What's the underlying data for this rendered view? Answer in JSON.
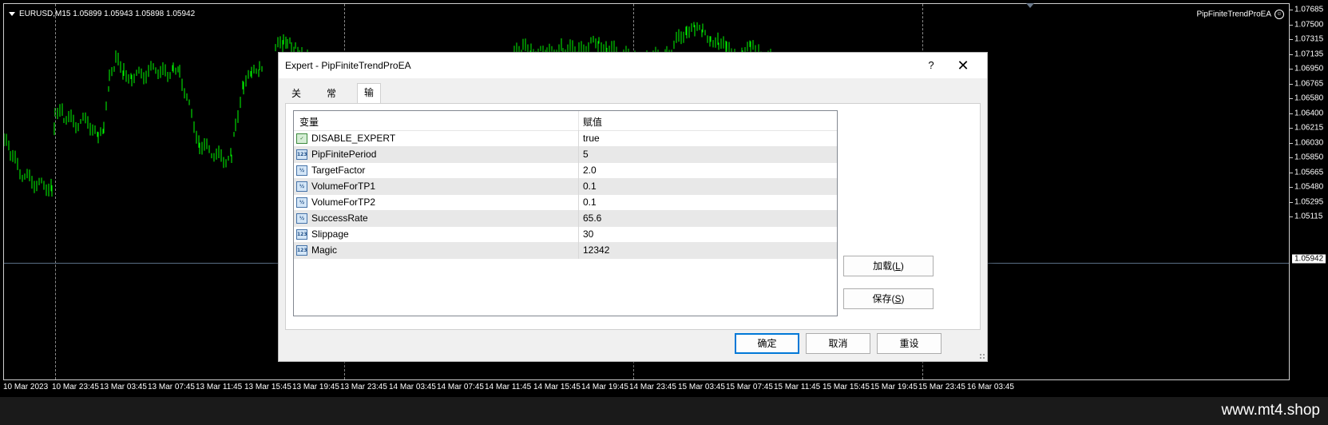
{
  "chart": {
    "symbol_info": "EURUSD,M15  1.05899 1.05943 1.05898 1.05942",
    "expert_name": "PipFiniteTrendProEA",
    "price_labels": [
      "1.07685",
      "1.07500",
      "1.07315",
      "1.07135",
      "1.06950",
      "1.06765",
      "1.06580",
      "1.06400",
      "1.06215",
      "1.06030",
      "1.05850",
      "1.05665",
      "1.05480",
      "1.05295",
      "1.05115"
    ],
    "current_price": "1.05942",
    "time_labels": [
      "10 Mar 2023",
      "10 Mar 23:45",
      "13 Mar 03:45",
      "13 Mar 07:45",
      "13 Mar 11:45",
      "13 Mar 15:45",
      "13 Mar 19:45",
      "13 Mar 23:45",
      "14 Mar 03:45",
      "14 Mar 07:45",
      "14 Mar 11:45",
      "14 Mar 15:45",
      "14 Mar 19:45",
      "14 Mar 23:45",
      "15 Mar 03:45",
      "15 Mar 07:45",
      "15 Mar 11:45",
      "15 Mar 15:45",
      "15 Mar 19:45",
      "15 Mar 23:45",
      "16 Mar 03:45"
    ],
    "candle_color": "#00ff00",
    "background_color": "#000000"
  },
  "dialog": {
    "title": "Expert - PipFiniteTrendProEA",
    "help_label": "?",
    "close_label": "✕",
    "tabs": [
      {
        "label": "关于"
      },
      {
        "label": "常用"
      },
      {
        "label": "输入参数"
      }
    ],
    "table": {
      "headers": {
        "name": "变量",
        "value": "赋值"
      },
      "rows": [
        {
          "icon": "bool-icon",
          "icon_text": "✓",
          "name": "DISABLE_EXPERT",
          "value": "true"
        },
        {
          "icon": "int-icon",
          "icon_text": "123",
          "name": "PipFinitePeriod",
          "value": "5"
        },
        {
          "icon": "double-icon",
          "icon_text": "½",
          "name": "TargetFactor",
          "value": "2.0"
        },
        {
          "icon": "double-icon",
          "icon_text": "½",
          "name": "VolumeForTP1",
          "value": "0.1"
        },
        {
          "icon": "double-icon",
          "icon_text": "½",
          "name": "VolumeForTP2",
          "value": "0.1"
        },
        {
          "icon": "double-icon",
          "icon_text": "½",
          "name": "SuccessRate",
          "value": "65.6"
        },
        {
          "icon": "int-icon",
          "icon_text": "123",
          "name": "Slippage",
          "value": "30"
        },
        {
          "icon": "int-icon",
          "icon_text": "123",
          "name": "Magic",
          "value": "12342"
        }
      ]
    },
    "load_button": {
      "text": "加载(",
      "key": "L",
      "end": ")"
    },
    "save_button": {
      "text": "保存(",
      "key": "S",
      "end": ")"
    },
    "ok_label": "确定",
    "cancel_label": "取消",
    "reset_label": "重设"
  },
  "footer": {
    "watermark": "www.mt4.shop"
  }
}
